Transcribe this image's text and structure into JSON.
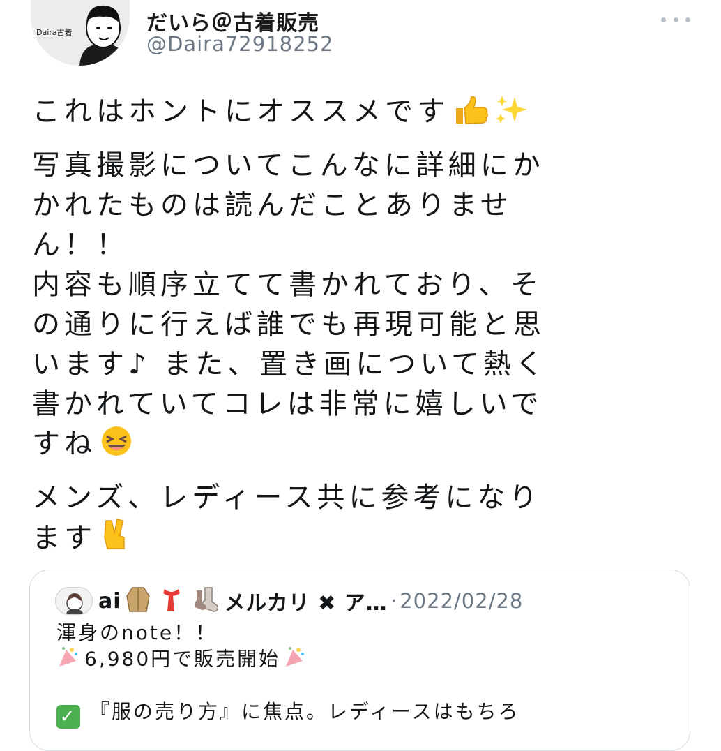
{
  "author": {
    "display_name": "だいら＠古着販売",
    "handle": "@Daira72918252",
    "avatar_text": "Daira古着"
  },
  "tweet": {
    "line1": "これはホントにオススメです",
    "line2": "写真撮影についてこんなに詳細にか",
    "line3": "かれたものは読んだことありませ",
    "line4": "ん！！",
    "line5": "内容も順序立てて書かれており、そ",
    "line6": "の通りに行えば誰でも再現可能と思",
    "line7": "います♪ また、置き画について熱く",
    "line8": "書かれていてコレは非常に嬉しいで",
    "line9": "すね",
    "line10": "メンズ、レディース共に参考になり",
    "line11": "ます"
  },
  "quoted": {
    "name": "ai",
    "name_suffix": "メルカリ ✖ ア…",
    "separator": "·",
    "date": "2022/02/28",
    "line1": "渾身のnote！！",
    "line2": "6,980円で販売開始",
    "line3": "『服の売り方』に焦点。レディースはもちろ"
  },
  "icons": {
    "more": "more-dots-icon",
    "thumbs_up": "thumbs-up-emoji",
    "sparkles": "sparkles-emoji",
    "laughing": "laughing-face-emoji",
    "victory": "victory-hand-emoji",
    "check": "white-check-mark-emoji"
  },
  "colors": {
    "text": "#14171a",
    "secondary": "#6b7785",
    "border": "#d5dbe0",
    "check_green": "#4caf50"
  }
}
